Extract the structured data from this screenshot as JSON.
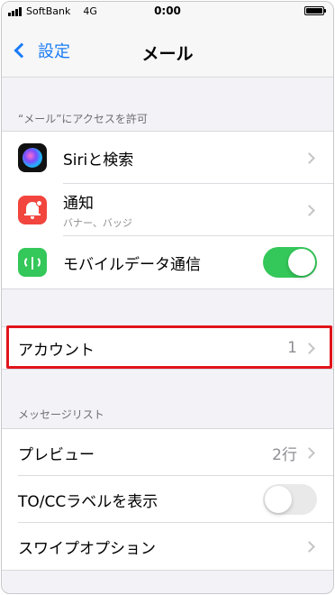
{
  "status_bar": {
    "carrier": "SoftBank",
    "network": "4G",
    "time": "0:00"
  },
  "nav": {
    "back_label": "設定",
    "title": "メール"
  },
  "access_section": {
    "header": "“メール”にアクセスを許可",
    "rows": [
      {
        "label": "Siriと検索",
        "icon": "siri-icon"
      },
      {
        "label": "通知",
        "sublabel": "バナー、バッジ",
        "icon": "bell-icon"
      },
      {
        "label": "モバイルデータ通信",
        "icon": "cellular-icon",
        "toggle": true
      }
    ]
  },
  "accounts": {
    "label": "アカウント",
    "value": "1"
  },
  "message_list_section": {
    "header": "メッセージリスト",
    "rows": [
      {
        "label": "プレビュー",
        "value": "2行"
      },
      {
        "label": "TO/CCラベルを表示",
        "toggle": false
      },
      {
        "label": "スワイプオプション"
      }
    ]
  },
  "colors": {
    "accent": "#1a7cf6",
    "toggle_on": "#34c759",
    "highlight": "#e1141b"
  }
}
